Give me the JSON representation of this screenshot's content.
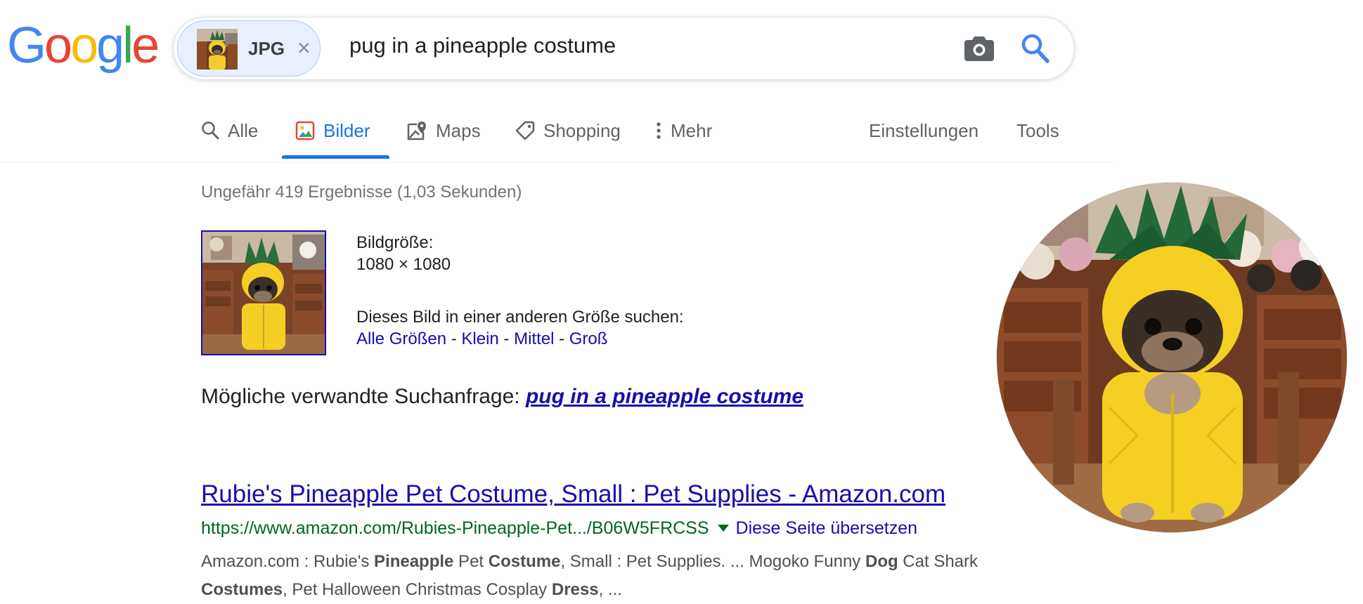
{
  "logo": {
    "letters": [
      "G",
      "o",
      "o",
      "g",
      "l",
      "e"
    ]
  },
  "search": {
    "chip_label": "JPG",
    "chip_close": "×",
    "query": "pug in a pineapple costume"
  },
  "tabs": {
    "alle": "Alle",
    "bilder": "Bilder",
    "maps": "Maps",
    "shopping": "Shopping",
    "mehr": "Mehr",
    "einstellungen": "Einstellungen",
    "tools": "Tools"
  },
  "results": {
    "stats": "Ungefähr 419 Ergebnisse (1,03 Sekunden)",
    "image_size_label": "Bildgröße:",
    "image_size_value": "1080 × 1080",
    "other_size_label": "Dieses Bild in einer anderen Größe suchen:",
    "size_links": [
      "Alle Größen",
      "Klein",
      "Mittel",
      "Groß"
    ],
    "size_sep": " - ",
    "related_label": "Mögliche verwandte Suchanfrage: ",
    "related_query": "pug in a pineapple costume",
    "first_result": {
      "title": "Rubie's Pineapple Pet Costume, Small : Pet Supplies - Amazon.com",
      "url": "https://www.amazon.com/Rubies-Pineapple-Pet.../B06W5FRCSS",
      "translate": "Diese Seite übersetzen",
      "snippet_parts": [
        {
          "t": "Amazon.com : Rubie's ",
          "b": false
        },
        {
          "t": "Pineapple",
          "b": true
        },
        {
          "t": " Pet ",
          "b": false
        },
        {
          "t": "Costume",
          "b": true
        },
        {
          "t": ", Small : Pet Supplies. ... Mogoko Funny ",
          "b": false
        },
        {
          "t": "Dog",
          "b": true
        },
        {
          "t": " Cat Shark ",
          "b": false
        },
        {
          "t": "Costumes",
          "b": true
        },
        {
          "t": ", Pet Halloween Christmas Cosplay ",
          "b": false
        },
        {
          "t": "Dress",
          "b": true
        },
        {
          "t": ", ...",
          "b": false
        }
      ]
    }
  },
  "colors": {
    "accent": "#1a73e8",
    "link": "#1a0dab",
    "url_green": "#006621",
    "chip_bg": "#e8f0fe",
    "logo_blue": "#4285f4",
    "logo_red": "#ea4335",
    "logo_yellow": "#fbbc05",
    "logo_green": "#34a853"
  },
  "icons": [
    "camera-icon",
    "search-icon",
    "magnifier-icon",
    "image-icon",
    "map-pin-icon",
    "tag-icon",
    "more-vert-icon"
  ]
}
